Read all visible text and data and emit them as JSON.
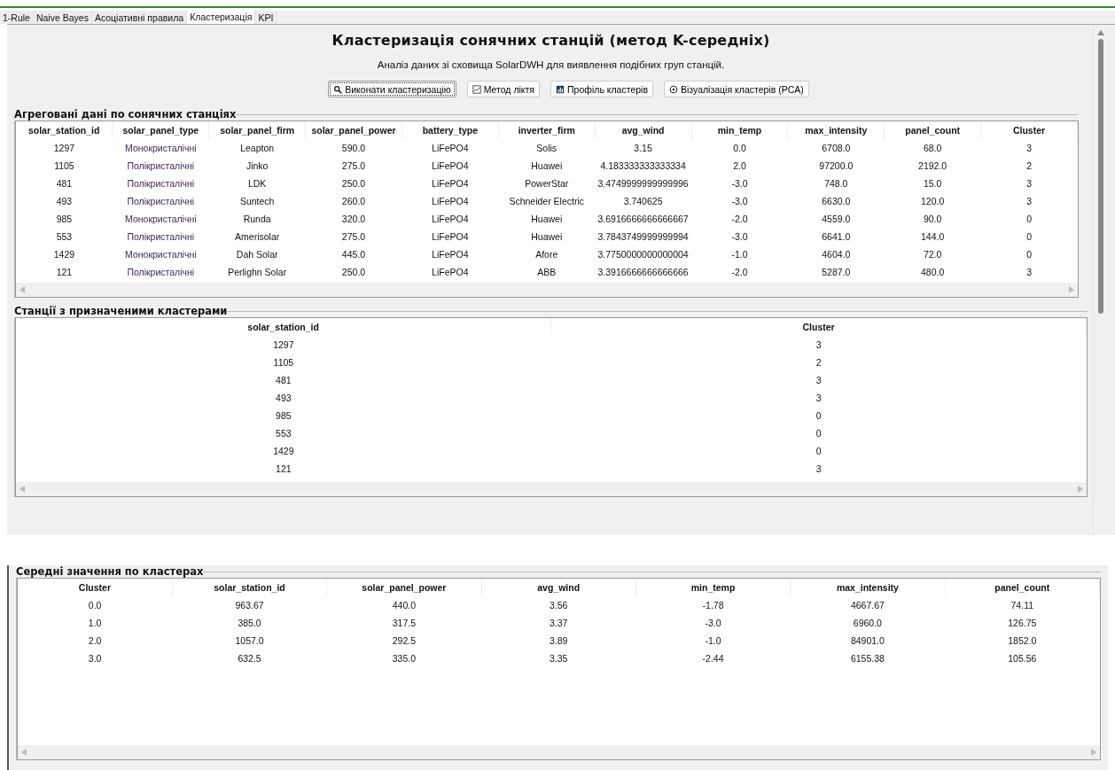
{
  "tabs": [
    {
      "label": "1-Rule",
      "selected": false
    },
    {
      "label": "Naive Bayes",
      "selected": false
    },
    {
      "label": "Асоціативні правила",
      "selected": false
    },
    {
      "label": "Кластеризація",
      "selected": true
    },
    {
      "label": "KPI",
      "selected": false
    }
  ],
  "title": "Кластеризація сонячних станцій (метод K-середніх)",
  "subtitle": "Аналіз даних зі сховища SolarDWH для виявлення подібних груп станцій.",
  "buttons": [
    {
      "label": "Виконати кластеризацію",
      "kind": "search",
      "focused": true
    },
    {
      "label": "Метод ліктя",
      "kind": "line",
      "focused": false
    },
    {
      "label": "Профіль кластерів",
      "kind": "bars",
      "focused": false
    },
    {
      "label": "Візуалізація кластерів (PCA)",
      "kind": "target",
      "focused": false
    }
  ],
  "aggregated": {
    "title": "Агреговані дані по сонячних станціях",
    "columns": [
      "solar_station_id",
      "solar_panel_type",
      "solar_panel_firm",
      "solar_panel_power",
      "battery_type",
      "inverter_firm",
      "avg_wind",
      "min_temp",
      "max_intensity",
      "panel_count",
      "Cluster"
    ],
    "rows": [
      [
        "1297",
        "Монокристалічні",
        "Leapton",
        "590.0",
        "LiFePO4",
        "Solis",
        "3.15",
        "0.0",
        "6708.0",
        "68.0",
        "3"
      ],
      [
        "1105",
        "Полікристалічні",
        "Jinko",
        "275.0",
        "LiFePO4",
        "Huawei",
        "4.183333333333334",
        "2.0",
        "97200.0",
        "2192.0",
        "2"
      ],
      [
        "481",
        "Полікристалічні",
        "LDK",
        "250.0",
        "LiFePO4",
        "PowerStar",
        "3.4749999999999996",
        "-3.0",
        "748.0",
        "15.0",
        "3"
      ],
      [
        "493",
        "Полікристалічні",
        "Suntech",
        "260.0",
        "LiFePO4",
        "Schneider Electric",
        "3.740625",
        "-3.0",
        "6630.0",
        "120.0",
        "3"
      ],
      [
        "985",
        "Монокристалічні",
        "Runda",
        "320.0",
        "LiFePO4",
        "Huawei",
        "3.6916666666666667",
        "-2.0",
        "4559.0",
        "90.0",
        "0"
      ],
      [
        "553",
        "Полікристалічні",
        "Amerisolar",
        "275.0",
        "LiFePO4",
        "Huawei",
        "3.7843749999999994",
        "-3.0",
        "6641.0",
        "144.0",
        "0"
      ],
      [
        "1429",
        "Монокристалічні",
        "Dah Solar",
        "445.0",
        "LiFePO4",
        "Afore",
        "3.7750000000000004",
        "-1.0",
        "4604.0",
        "72.0",
        "0"
      ],
      [
        "121",
        "Полікристалічні",
        "Perlighn Solar",
        "250.0",
        "LiFePO4",
        "ABB",
        "3.3916666666666666",
        "-2.0",
        "5287.0",
        "480.0",
        "3"
      ]
    ]
  },
  "assigned": {
    "title": "Станції з призначеними кластерами",
    "columns": [
      "solar_station_id",
      "Cluster"
    ],
    "rows": [
      [
        "1297",
        "3"
      ],
      [
        "1105",
        "2"
      ],
      [
        "481",
        "3"
      ],
      [
        "493",
        "3"
      ],
      [
        "985",
        "0"
      ],
      [
        "553",
        "0"
      ],
      [
        "1429",
        "0"
      ],
      [
        "121",
        "3"
      ]
    ]
  },
  "means": {
    "title": "Середні значення по кластерах",
    "columns": [
      "Cluster",
      "solar_station_id",
      "solar_panel_power",
      "avg_wind",
      "min_temp",
      "max_intensity",
      "panel_count"
    ],
    "rows": [
      [
        "0.0",
        "963.67",
        "440.0",
        "3.56",
        "-1.78",
        "4667.67",
        "74.11"
      ],
      [
        "1.0",
        "385.0",
        "317.5",
        "3.37",
        "-3.0",
        "6960.0",
        "126.75"
      ],
      [
        "2.0",
        "1057.0",
        "292.5",
        "3.89",
        "-1.0",
        "84901.0",
        "1852.0"
      ],
      [
        "3.0",
        "632.5",
        "335.0",
        "3.35",
        "-2.44",
        "6155.38",
        "105.56"
      ]
    ]
  }
}
